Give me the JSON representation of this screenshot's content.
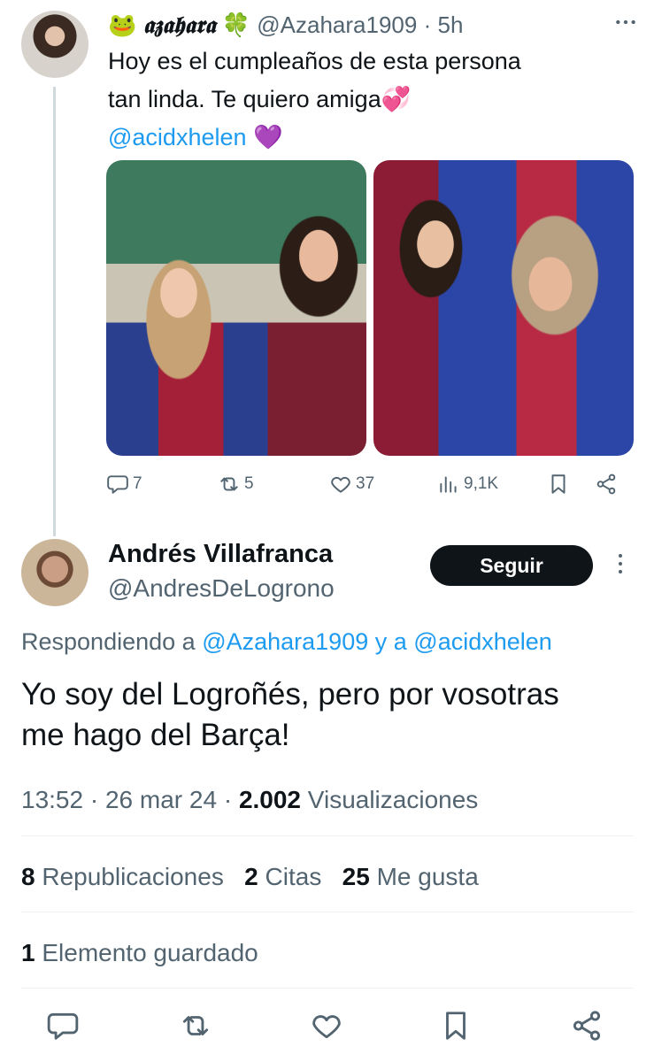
{
  "parent": {
    "emoji_prefix": "🐸",
    "display_name": "𝖆𝖟𝖆𝖍𝖆𝖗𝖆",
    "emoji_suffix": "🍀",
    "handle": "@Azahara1909",
    "separator": "·",
    "time": "5h",
    "text_line1": "Hoy es el cumpleaños de esta persona",
    "text_line2": "tan linda. Te quiero amiga💞",
    "mention": "@acidxhelen",
    "mention_emoji": "💜",
    "actions": {
      "replies": "7",
      "reposts": "5",
      "likes": "37",
      "views": "9,1K"
    }
  },
  "reply": {
    "display_name": "Andrés Villafranca",
    "handle": "@AndresDeLogrono",
    "follow_label": "Seguir",
    "replying_prefix": "Respondiendo a",
    "replying_user1": "@Azahara1909",
    "replying_and": "y a",
    "replying_user2": "@acidxhelen",
    "text_line1": "Yo soy del Logroñés, pero por vosotras",
    "text_line2": "me hago del Barça!",
    "time": "13:52",
    "date": "26 mar 24",
    "views_count": "2.002",
    "views_label": "Visualizaciones",
    "reposts_count": "8",
    "reposts_label": "Republicaciones",
    "quotes_count": "2",
    "quotes_label": "Citas",
    "likes_count": "25",
    "likes_label": "Me gusta",
    "bookmarks_count": "1",
    "bookmarks_label": "Elemento guardado"
  },
  "icons": {
    "reply": "reply-icon",
    "repost": "repost-icon",
    "like": "heart-icon",
    "views": "views-icon",
    "bookmark": "bookmark-icon",
    "share": "share-icon",
    "more": "more-icon"
  },
  "colors": {
    "accent": "#1d9bf0",
    "text": "#0f1419",
    "muted": "#536471",
    "follow_bg": "#0f1419"
  }
}
